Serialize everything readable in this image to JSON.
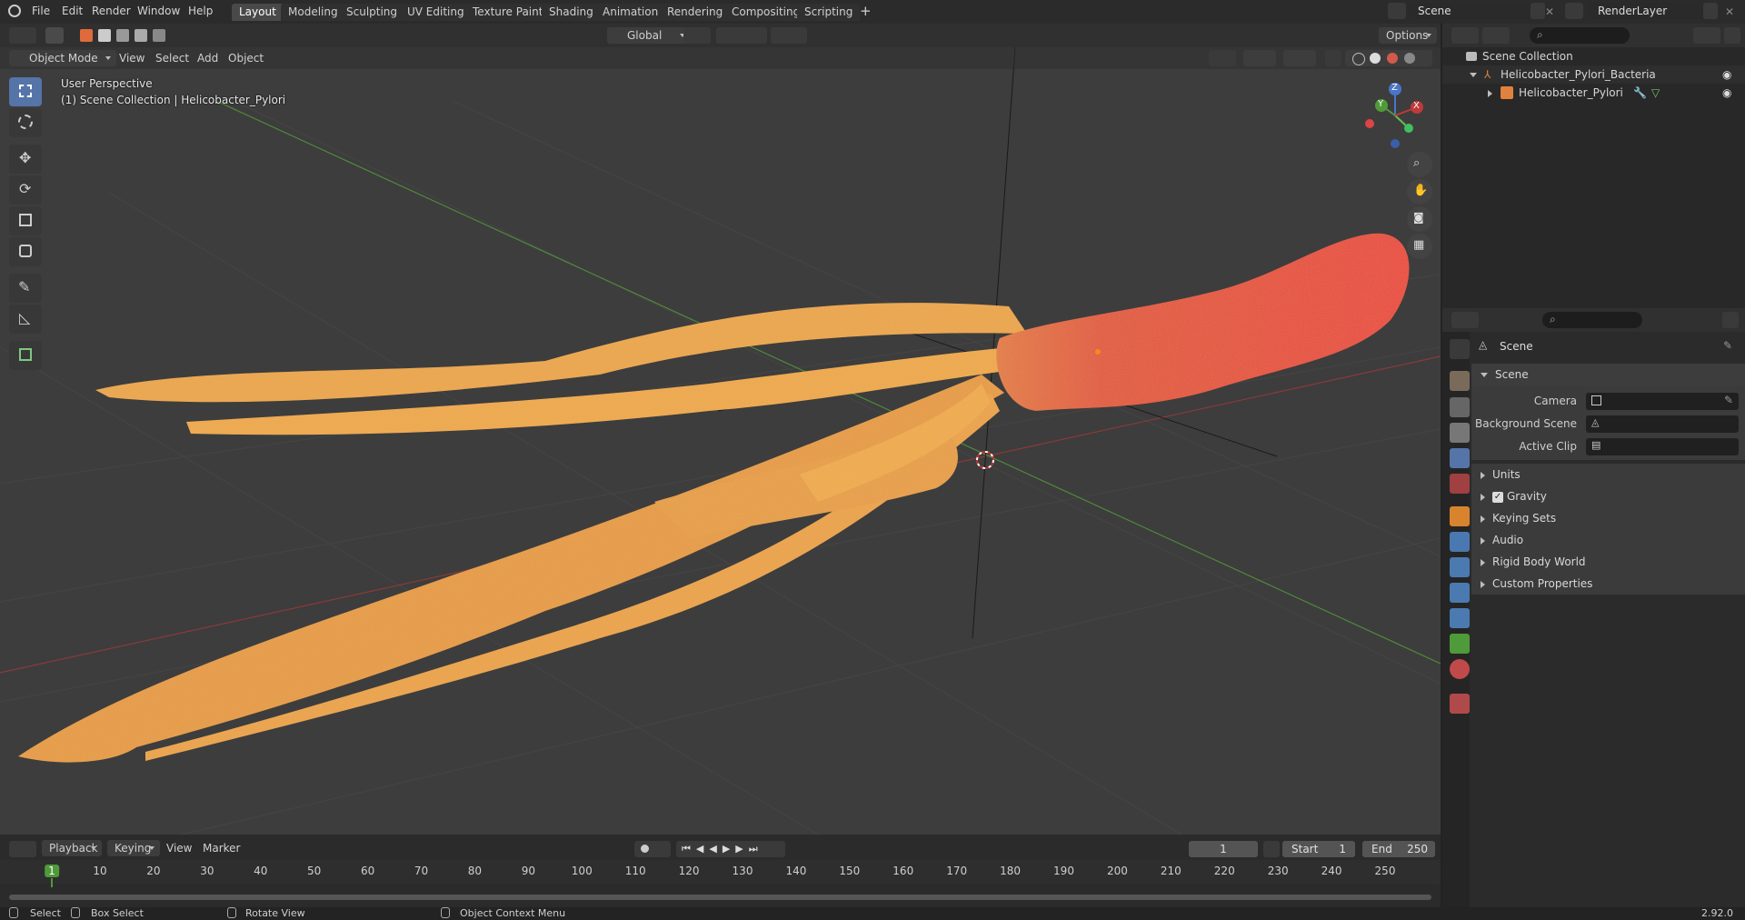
{
  "topbar": {
    "menus": [
      "File",
      "Edit",
      "Render",
      "Window",
      "Help"
    ],
    "workspaces": [
      "Layout",
      "Modeling",
      "Sculpting",
      "UV Editing",
      "Texture Paint",
      "Shading",
      "Animation",
      "Rendering",
      "Compositing",
      "Scripting"
    ],
    "active_workspace": "Layout",
    "add_tab": "+",
    "scene_name": "Scene",
    "view_layer": "RenderLayer"
  },
  "viewport_header": {
    "mode": "Object Mode",
    "menus": [
      "View",
      "Select",
      "Add",
      "Object"
    ],
    "orientation": "Global",
    "options": "Options"
  },
  "viewport": {
    "perspective": "User Perspective",
    "collection_info": "(1) Scene Collection | Helicobacter_Pylori",
    "gizmo": {
      "z": "Z",
      "y": "Y",
      "x": "X"
    }
  },
  "outliner": {
    "root": "Scene Collection",
    "collection": "Helicobacter_Pylori_Bacteria",
    "object": "Helicobacter_Pylori"
  },
  "properties": {
    "context": "Scene",
    "panel": "Scene",
    "fields": [
      {
        "label": "Camera"
      },
      {
        "label": "Background Scene"
      },
      {
        "label": "Active Clip"
      }
    ],
    "subpanels": [
      "Units",
      "Gravity",
      "Keying Sets",
      "Audio",
      "Rigid Body World",
      "Custom Properties"
    ],
    "gravity_enabled": true
  },
  "timeline": {
    "menus": {
      "playback": "Playback",
      "keying": "Keying",
      "view": "View",
      "marker": "Marker"
    },
    "current_frame": "1",
    "start_label": "Start",
    "start": "1",
    "end_label": "End",
    "end": "250",
    "ticks": [
      "1",
      "10",
      "20",
      "30",
      "40",
      "50",
      "60",
      "70",
      "80",
      "90",
      "100",
      "110",
      "120",
      "130",
      "140",
      "150",
      "160",
      "170",
      "180",
      "190",
      "200",
      "210",
      "220",
      "230",
      "240",
      "250"
    ]
  },
  "statusbar": {
    "select": "Select",
    "box_select": "Box Select",
    "rotate_view": "Rotate View",
    "context_menu": "Object Context Menu",
    "version": "2.92.0"
  },
  "colors": {
    "accent": "#5574a8",
    "x_axis": "#c03a3a",
    "y_axis": "#4f9a3a",
    "z_axis": "#4a76c8",
    "flagella": "#f1a22b",
    "body": "#e63c1f"
  }
}
